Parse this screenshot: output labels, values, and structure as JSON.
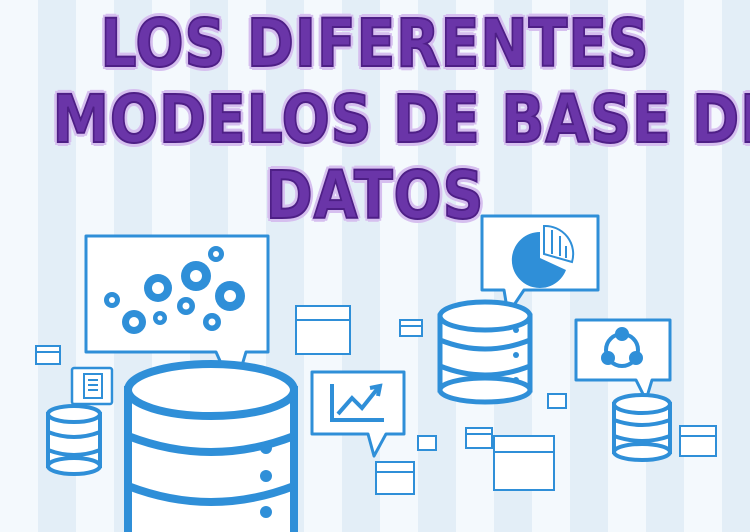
{
  "title": {
    "line1": "LOS DIFERENTES",
    "line2": "MODELOS DE BASE DE",
    "line3": "DATOS"
  },
  "colors": {
    "accent_blue": "#2f8fd8",
    "title_purple": "#6a35a8",
    "title_glow": "#d6bfef"
  },
  "icons": [
    "gears-icon",
    "database-icon",
    "pie-chart-icon",
    "line-chart-icon",
    "network-cycle-icon",
    "document-icon",
    "box-icon"
  ]
}
